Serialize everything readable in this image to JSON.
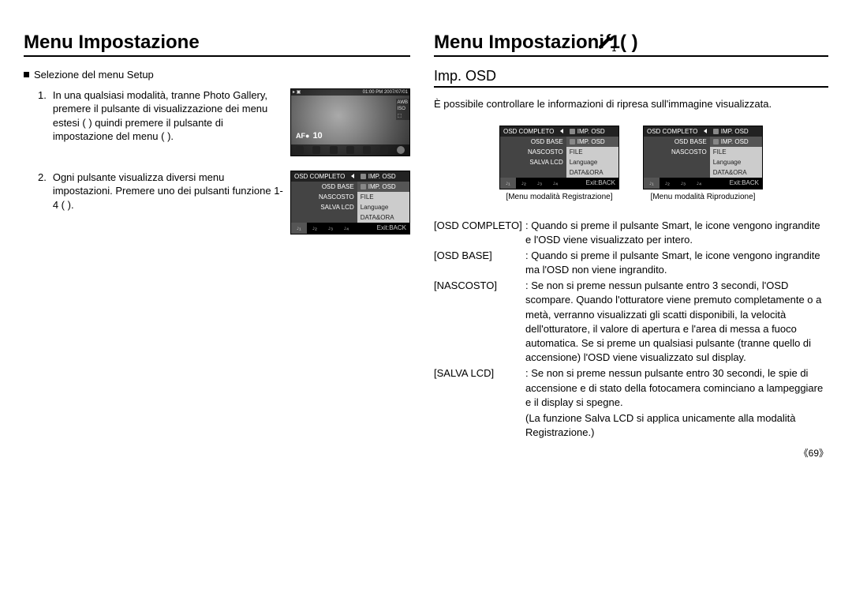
{
  "left": {
    "heading": "Menu Impostazione",
    "bullet": "Selezione del menu Setup",
    "step1_num": "1.",
    "step1": "In una qualsiasi modalità, tranne Photo Gallery, premere il pulsante di visualizzazione dei menu estesi (        ) quindi premere il pulsante di impostazione del menu (        ).",
    "step2_num": "2.",
    "step2": "Ogni pulsante visualizza diversi menu impostazioni. Premere uno dei pulsanti funzione 1-4 (                 ).",
    "lcd": {
      "topbar_left": "▸ ▣",
      "topbar_right": "01:00 PM 2007/07/01",
      "side": [
        "AWB",
        "ISO",
        "⬚"
      ],
      "af": "AF●",
      "count": "10",
      "menu": {
        "header_left": "OSD COMPLETO",
        "header_right": "IMP. OSD",
        "rows": [
          {
            "l": "OSD BASE",
            "r": "IMP. OSD",
            "sub": true
          },
          {
            "l": "NASCOSTO",
            "r": "FILE"
          },
          {
            "l": "SALVA LCD",
            "r": "Language"
          },
          {
            "l": "",
            "r": "DATA&ORA"
          }
        ],
        "exit": "Exit:BACK"
      }
    }
  },
  "right": {
    "heading": "Menu Impostazioni 1(       )",
    "subheading": "Imp. OSD",
    "intro": "È possibile controllare le informazioni di ripresa sull'immagine visualizzata.",
    "menus": {
      "rec_caption": "[Menu modalità Registrazione]",
      "play_caption": "[Menu modalità Riproduzione]",
      "rec": {
        "header_left": "OSD COMPLETO",
        "header_right": "IMP. OSD",
        "rows": [
          {
            "l": "OSD BASE",
            "r": "IMP. OSD",
            "sub": true
          },
          {
            "l": "NASCOSTO",
            "r": "FILE"
          },
          {
            "l": "SALVA LCD",
            "r": "Language"
          },
          {
            "l": "",
            "r": "DATA&ORA"
          }
        ],
        "exit": "Exit:BACK"
      },
      "play": {
        "header_left": "OSD COMPLETO",
        "header_right": "IMP. OSD",
        "rows": [
          {
            "l": "OSD BASE",
            "r": "IMP. OSD",
            "sub": true
          },
          {
            "l": "NASCOSTO",
            "r": "FILE"
          },
          {
            "l": "",
            "r": "Language"
          },
          {
            "l": "",
            "r": "DATA&ORA"
          }
        ],
        "exit": "Exit:BACK"
      }
    },
    "defs": [
      {
        "k": "[OSD COMPLETO]",
        "v": ": Quando si preme il pulsante Smart, le icone vengono ingrandite e l'OSD viene visualizzato per intero."
      },
      {
        "k": "[OSD BASE]",
        "v": ": Quando si preme il pulsante Smart, le icone vengono ingrandite ma l'OSD non viene ingrandito."
      },
      {
        "k": "[NASCOSTO]",
        "v": ": Se non si preme nessun pulsante entro 3 secondi, l'OSD scompare. Quando l'otturatore viene premuto completamente o a metà, verranno visualizzati gli scatti disponibili, la velocità dell'otturatore, il valore di apertura e l'area di messa a fuoco automatica.   Se si preme un qualsiasi pulsante (tranne quello di accensione) l'OSD viene visualizzato sul display."
      },
      {
        "k": "[SALVA LCD]",
        "v": ": Se non si preme nessun pulsante entro 30 secondi, le spie di accensione e di stato della fotocamera cominciano a lampeggiare e il display si spegne."
      }
    ],
    "note": "(La funzione Salva LCD si applica unicamente alla modalità Registrazione.)",
    "pagenum": "《69》"
  }
}
